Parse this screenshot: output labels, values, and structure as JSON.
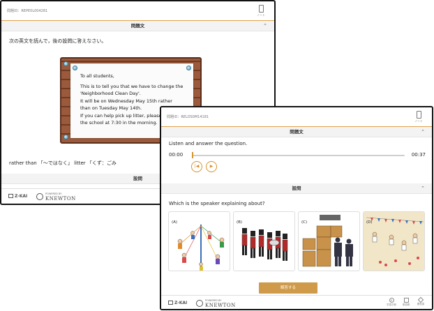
{
  "back_screen": {
    "question_id": "問題ID：REPE0L004281",
    "note_label": "ノート",
    "passage_header": "問題文",
    "instruction": "次の英文を読んで，後の設問に答えなさい。",
    "notice_lines": [
      "To all students,",
      "This is to tell you that we have to change the",
      "'Neighborhood Clean Day'.",
      "It will be on Wednesday May 15th rather",
      "than on Tuesday May 14th.",
      "If you can help pick up litter, please",
      "the school at 7:30 in the morning."
    ],
    "vocab_note": "rather than 「～ではなく」 litter 「くず：ごみ",
    "question_header": "設問",
    "cut_text": "・・・",
    "footer": {
      "zkai_logo": "Z-KAI",
      "powered_by": "POWERED BY",
      "knewton_logo": "KNEWTON"
    }
  },
  "front_screen": {
    "question_id": "問題ID：RELOS0M14181",
    "note_label": "ノート",
    "passage_header": "問題文",
    "instruction": "Listen and answer the question.",
    "audio": {
      "current_time": "00:00",
      "total_time": "00:37",
      "progress": 0.0
    },
    "question_header": "設問",
    "question": "Which is the speaker explaining about?",
    "choices": [
      {
        "letter": "(A)"
      },
      {
        "letter": "(B)"
      },
      {
        "letter": "(C)"
      },
      {
        "letter": "(D)"
      }
    ],
    "submit_label": "解答する",
    "footer": {
      "zkai_logo": "Z-KAI",
      "powered_by": "POWERED BY",
      "knewton_logo": "KNEWTON",
      "buttons": [
        "学習中断",
        "単語帳",
        "要復習"
      ]
    }
  },
  "colors": {
    "accent": "#d8922e",
    "submit": "#cf9a49",
    "board": "#9b5a3b"
  }
}
